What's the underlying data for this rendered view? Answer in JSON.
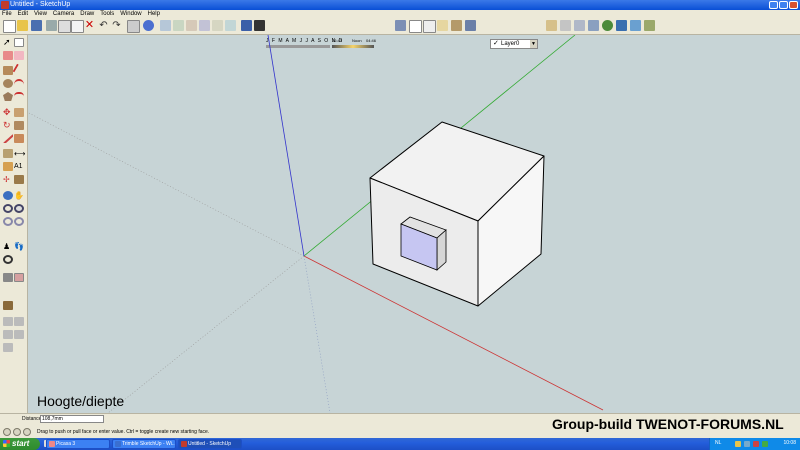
{
  "window": {
    "title": "Untitled - SketchUp"
  },
  "menu": [
    "File",
    "Edit",
    "View",
    "Camera",
    "Draw",
    "Tools",
    "Window",
    "Help"
  ],
  "shadow_settings": {
    "months": "J F M A M J J A S O N D",
    "time_start": "06:43",
    "time_mid": "Noon",
    "time_end": "04:46"
  },
  "layer": {
    "current": "Layer0"
  },
  "measurements": {
    "label": "Distance",
    "value": "108,7mm"
  },
  "status": {
    "hint": "Drag to push or pull face or enter value.  Ctrl = toggle create new starting face."
  },
  "overlay": {
    "caption": "Hoogte/diepte",
    "watermark": "Group-build TWENOT-FORUMS.NL"
  },
  "taskbar": {
    "start_label": "start",
    "tasks": [
      "Picasa 3",
      "Trimble SketchUp - Wi...",
      "Untitled - SketchUp"
    ],
    "language": "NL",
    "clock": "10:08"
  },
  "colors": {
    "red_axis": "#cc3333",
    "green_axis": "#33aa33",
    "blue_axis": "#3333cc",
    "background": "#c7d4d6"
  }
}
